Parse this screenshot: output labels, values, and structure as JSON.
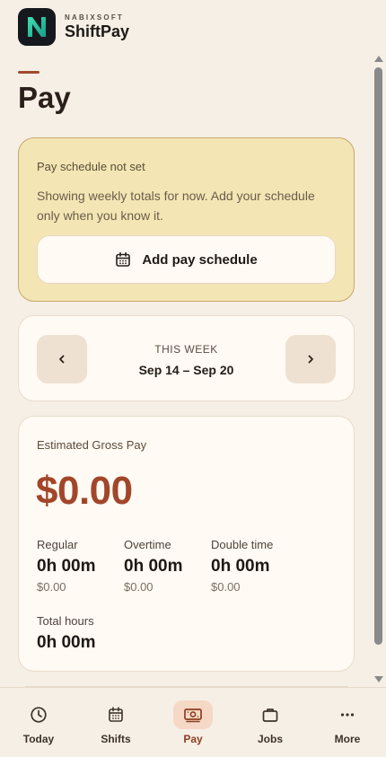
{
  "brand": {
    "company": "NABIXSOFT",
    "app_name": "ShiftPay"
  },
  "page": {
    "title": "Pay"
  },
  "notice": {
    "title": "Pay schedule not set",
    "body": "Showing weekly totals for now. Add your schedule only when you know it.",
    "button_label": "Add pay schedule"
  },
  "week": {
    "label": "THIS WEEK",
    "range": "Sep 14 – Sep 20"
  },
  "pay": {
    "gross_label": "Estimated Gross Pay",
    "gross_amount": "$0.00",
    "regular": {
      "label": "Regular",
      "hours": "0h 00m",
      "amount": "$0.00"
    },
    "overtime": {
      "label": "Overtime",
      "hours": "0h 00m",
      "amount": "$0.00"
    },
    "double_time": {
      "label": "Double time",
      "hours": "0h 00m",
      "amount": "$0.00"
    },
    "total": {
      "label": "Total hours",
      "hours": "0h 00m"
    }
  },
  "tabs": [
    {
      "label": "Today",
      "icon": "clock-icon"
    },
    {
      "label": "Shifts",
      "icon": "calendar-icon"
    },
    {
      "label": "Pay",
      "icon": "cash-icon",
      "active": true
    },
    {
      "label": "Jobs",
      "icon": "briefcase-icon"
    },
    {
      "label": "More",
      "icon": "more-dots-icon"
    }
  ],
  "colors": {
    "background": "#f6efe6",
    "accent": "#a2462a",
    "notice_bg": "#f3e6b4",
    "card_bg": "#fffaf3",
    "active_tab_bg": "#f5d9c6"
  }
}
